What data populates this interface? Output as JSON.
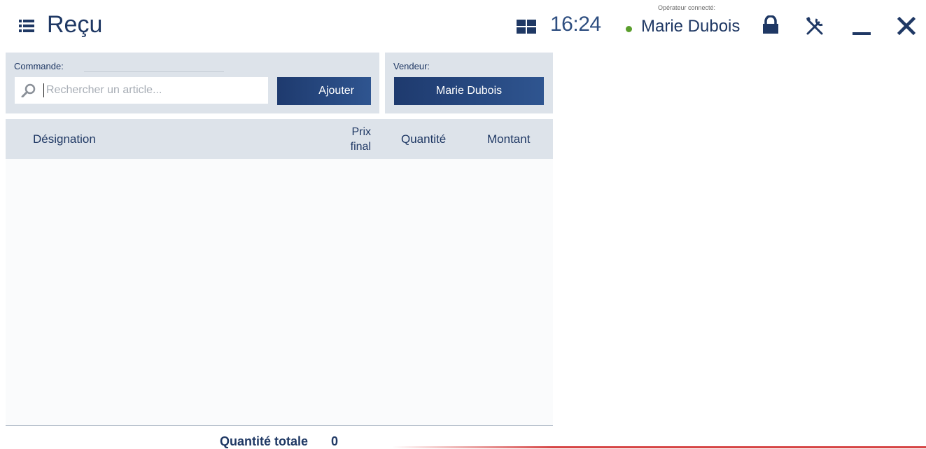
{
  "header": {
    "title": "Reçu",
    "clock": "16:24",
    "operator_caption": "Opérateur connecté:",
    "operator_name": "Marie Dubois",
    "status_color": "#5a9e2c"
  },
  "icons": {
    "menu": "list-menu-icon",
    "tiles": "tiles-icon",
    "lock": "lock-icon",
    "tools": "tools-icon",
    "minimize": "minimize-icon",
    "close": "close-icon",
    "search": "search-icon"
  },
  "order": {
    "label": "Commande:",
    "search_placeholder": "Rechercher un article...",
    "search_value": "",
    "add_label": "Ajouter"
  },
  "seller": {
    "label": "Vendeur:",
    "name": "Marie Dubois"
  },
  "table": {
    "columns": {
      "designation": "Désignation",
      "price_line1": "Prix",
      "price_line2": "final",
      "quantity": "Quantité",
      "amount": "Montant"
    },
    "rows": []
  },
  "footer": {
    "total_label": "Quantité totale",
    "total_value": "0"
  },
  "colors": {
    "accent": "#1f3864",
    "button": "#1e3a6e",
    "panel": "#dde3ea",
    "alert_line": "#d64646"
  }
}
